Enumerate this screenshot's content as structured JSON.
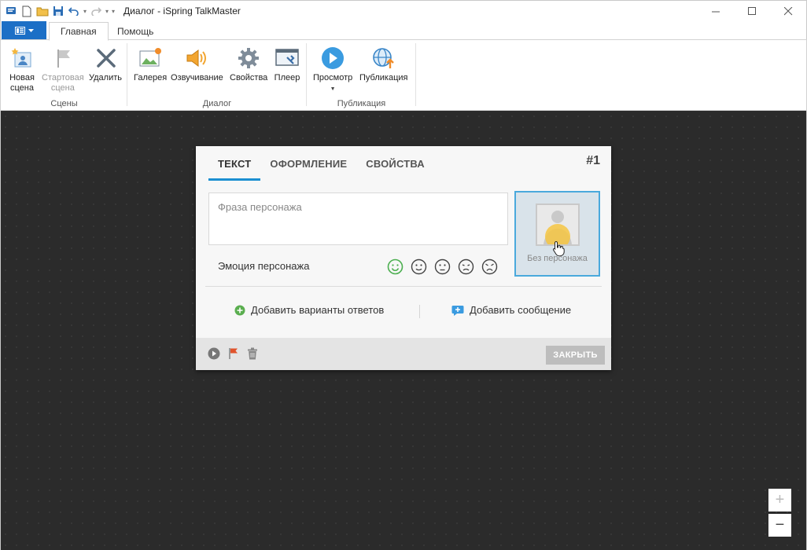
{
  "window": {
    "title": "Диалог - iSpring TalkMaster"
  },
  "tabs": {
    "home": "Главная",
    "help": "Помощь"
  },
  "ribbon": {
    "groups": [
      {
        "label": "Сцены",
        "buttons": [
          {
            "label1": "Новая",
            "label2": "сцена",
            "icon": "new-scene-icon",
            "enabled": true
          },
          {
            "label1": "Стартовая",
            "label2": "сцена",
            "icon": "start-flag-icon",
            "enabled": false
          },
          {
            "label1": "Удалить",
            "label2": "",
            "icon": "delete-x-icon",
            "enabled": true
          }
        ]
      },
      {
        "label": "Диалог",
        "buttons": [
          {
            "label1": "Галерея",
            "icon": "gallery-icon"
          },
          {
            "label1": "Озвучивание",
            "icon": "speaker-icon"
          },
          {
            "label1": "Свойства",
            "icon": "gear-icon"
          },
          {
            "label1": "Плеер",
            "icon": "player-icon"
          }
        ]
      },
      {
        "label": "Публикация",
        "buttons": [
          {
            "label1": "Просмотр",
            "icon": "play-icon",
            "has_dropdown": true
          },
          {
            "label1": "Публикация",
            "icon": "globe-publish-icon"
          }
        ]
      }
    ]
  },
  "dialog": {
    "tabs": [
      "ТЕКСТ",
      "ОФОРМЛЕНИЕ",
      "СВОЙСТВА"
    ],
    "active_tab": 0,
    "number": "#1",
    "phrase_placeholder": "Фраза персонажа",
    "character_label": "Без персонажа",
    "emotion_label": "Эмоция персонажа",
    "emotions": [
      "happy",
      "neutral",
      "sad-slight",
      "upset",
      "angry"
    ],
    "selected_emotion": "happy",
    "add_answers": "Добавить варианты ответов",
    "add_message": "Добавить сообщение",
    "close": "ЗАКРЫТЬ"
  },
  "zoom": {
    "plus": "+",
    "minus": "−"
  },
  "colors": {
    "accent": "#1b8fd1",
    "file_button": "#1c6fc6",
    "canvas": "#2b2b2b",
    "emotion_selected": "#4caf50"
  }
}
